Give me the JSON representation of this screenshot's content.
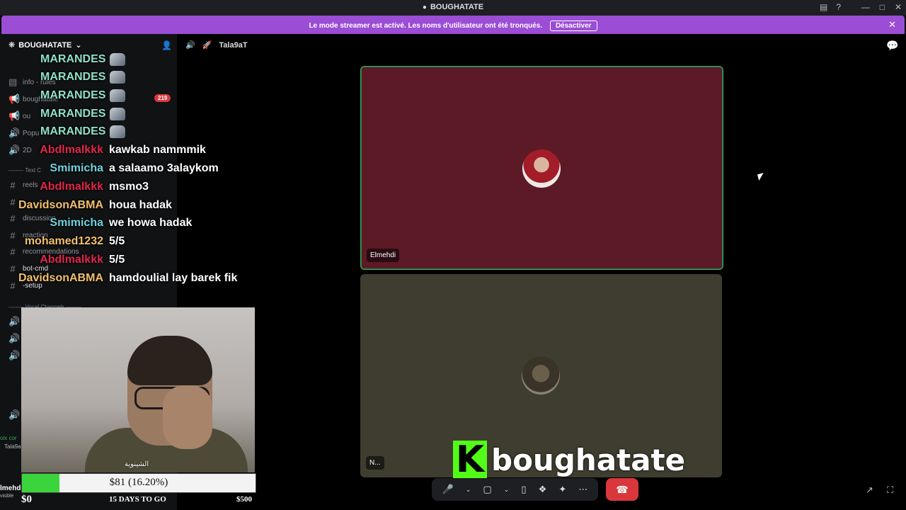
{
  "window": {
    "title": "BOUGHATATE"
  },
  "banner": {
    "message": "Le mode streamer est activé. Noms d'utilisateur ont été tronqués.",
    "message_full": "Le mode streamer est activé. Les noms d'utilisateur ont été tronqués.",
    "button": "Désactiver"
  },
  "sidebar": {
    "server_name": "BOUGHATATE",
    "channels": [
      {
        "label": "info - rules"
      },
      {
        "label": "boughatate"
      },
      {
        "label": "ou"
      },
      {
        "label": "Popu"
      },
      {
        "label": "2D"
      },
      {
        "label": "reels"
      },
      {
        "label": "discussion"
      },
      {
        "label": "reaction"
      },
      {
        "label": "recommendations"
      },
      {
        "label": "bot-cmd"
      },
      {
        "label": "-setup"
      }
    ],
    "categories": [
      "-------- Text C",
      "-------- Vocal Channels --------"
    ],
    "mention_count": "219",
    "bottom_texts": [
      "oix cor",
      "Tala9a",
      "lmehdi",
      "visible"
    ]
  },
  "chat": [
    {
      "name": "MARANDES",
      "message": "",
      "color": "#8fe0c9",
      "emote": true
    },
    {
      "name": "MARANDES",
      "message": "",
      "color": "#8fe0c9",
      "emote": true
    },
    {
      "name": "MARANDES",
      "message": "",
      "color": "#8fe0c9",
      "emote": true
    },
    {
      "name": "MARANDES",
      "message": "",
      "color": "#8fe0c9",
      "emote": true
    },
    {
      "name": "MARANDES",
      "message": "",
      "color": "#8fe0c9",
      "emote": true
    },
    {
      "name": "Abdlmalkkk",
      "message": "kawkab nammmik",
      "color": "#e2264d"
    },
    {
      "name": "Smimicha",
      "message": "a salaamo 3alaykom",
      "color": "#6fd3e0"
    },
    {
      "name": "Abdlmalkkk",
      "message": "msmo3",
      "color": "#e2264d"
    },
    {
      "name": "DavidsonABMA",
      "message": "houa hadak",
      "color": "#f3c06a"
    },
    {
      "name": "Smimicha",
      "message": "we howa hadak",
      "color": "#6fd3e0"
    },
    {
      "name": "mohamed1232",
      "message": "5/5",
      "color": "#f3c06a"
    },
    {
      "name": "Abdlmalkkk",
      "message": "5/5",
      "color": "#e2264d"
    },
    {
      "name": "DavidsonABMA",
      "message": "hamdoulial lay barek fik",
      "color": "#f3c06a"
    }
  ],
  "webcam": {
    "caption": "الشينوية"
  },
  "goal": {
    "text": "$81 (16.20%)",
    "progress": 0.162,
    "start": "$0",
    "days": "15 DAYS TO GO",
    "target": "$500",
    "color": "#3cd43c"
  },
  "main": {
    "channel": "Tala9aT",
    "tiles": [
      {
        "name": "Elmehdi",
        "bg": "#5c1a26"
      },
      {
        "name": "N...",
        "bg": "#3f3d30"
      }
    ]
  },
  "kick": {
    "logo": "K",
    "text": "boughatate",
    "color": "#53fc18"
  }
}
